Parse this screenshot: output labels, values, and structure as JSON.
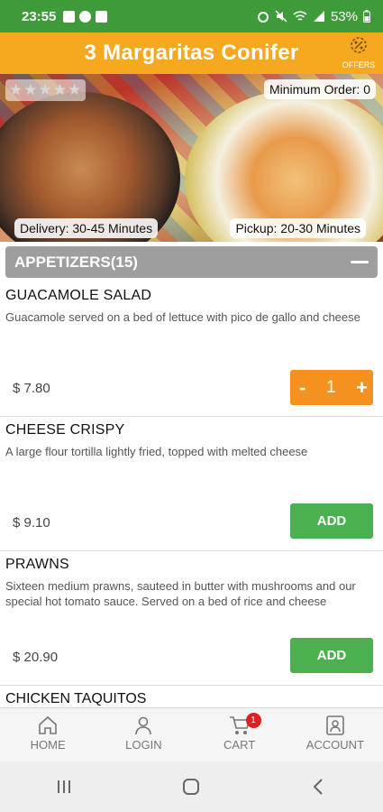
{
  "status_bar": {
    "time": "23:55",
    "battery": "53%"
  },
  "header": {
    "title": "3 Margaritas Conifer",
    "offers_label": "OFFERS"
  },
  "hero": {
    "rating": "★★★★★",
    "min_order_label": "Minimum Order:",
    "min_order_value": "0",
    "delivery_label": "Delivery:",
    "delivery_value": "30-45 Minutes",
    "pickup_label": "Pickup:",
    "pickup_value": "20-30 Minutes"
  },
  "category": {
    "title": "APPETIZERS(15)"
  },
  "items": [
    {
      "name": "GUACAMOLE SALAD",
      "description": "Guacamole served on a bed of lettuce with pico de gallo and cheese",
      "price": "$ 7.80",
      "quantity": "1",
      "minus": "-",
      "plus": "+"
    },
    {
      "name": "CHEESE CRISPY",
      "description": "A large flour tortilla lightly fried, topped with melted cheese",
      "price": "$ 9.10",
      "button": "ADD"
    },
    {
      "name": "PRAWNS",
      "description": "Sixteen medium prawns, sauteed in butter with mushrooms and our special hot tomato sauce. Served on a bed of rice and cheese",
      "price": "$ 20.90",
      "button": "ADD"
    }
  ],
  "partial_item": {
    "name": "CHICKEN TAQUITOS"
  },
  "bottom_nav": {
    "home": "HOME",
    "login": "LOGIN",
    "cart": "CART",
    "cart_count": "1",
    "account": "ACCOUNT"
  },
  "colors": {
    "status_green": "#3f9b3a",
    "header_orange": "#f6a91f",
    "add_green": "#4caf50",
    "stepper_orange": "#f4921f",
    "category_gray": "#9e9e9e"
  }
}
